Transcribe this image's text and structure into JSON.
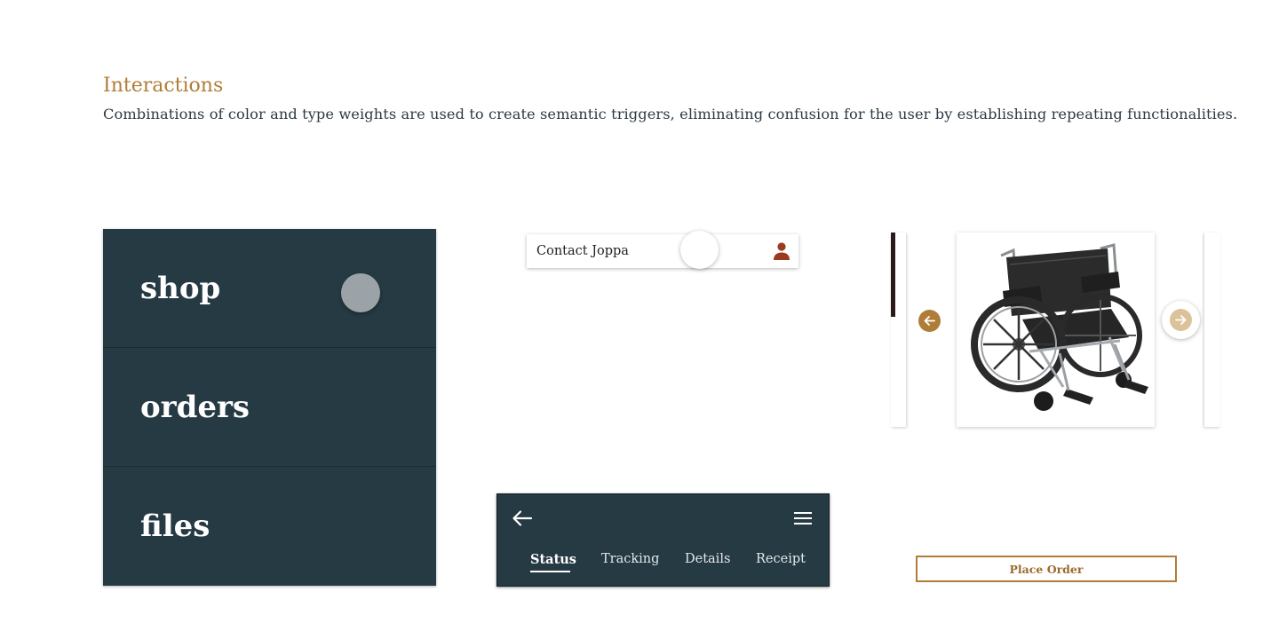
{
  "header": {
    "title": "Interactions",
    "description": "Combinations of color and type weights are used to create semantic triggers, eliminating confusion for the user by establishing repeating functionalities."
  },
  "nav_menu": {
    "items": [
      {
        "label": "shop"
      },
      {
        "label": "orders"
      },
      {
        "label": "files"
      }
    ]
  },
  "contact": {
    "label": "Contact Joppa",
    "icon": "person-icon"
  },
  "order_status": {
    "tabs": [
      {
        "label": "Status",
        "active": true
      },
      {
        "label": "Tracking",
        "active": false
      },
      {
        "label": "Details",
        "active": false
      },
      {
        "label": "Receipt",
        "active": false
      }
    ],
    "icons": [
      "back-arrow-icon",
      "hamburger-menu-icon"
    ]
  },
  "carousel": {
    "product_image": "wheelchair",
    "icons": [
      "arrow-left-icon",
      "arrow-right-icon"
    ],
    "cta_label": "Place Order"
  },
  "colors": {
    "accent_gold": "#b07d38",
    "navy": "#263a44",
    "person_icon": "#9a3a1e"
  }
}
